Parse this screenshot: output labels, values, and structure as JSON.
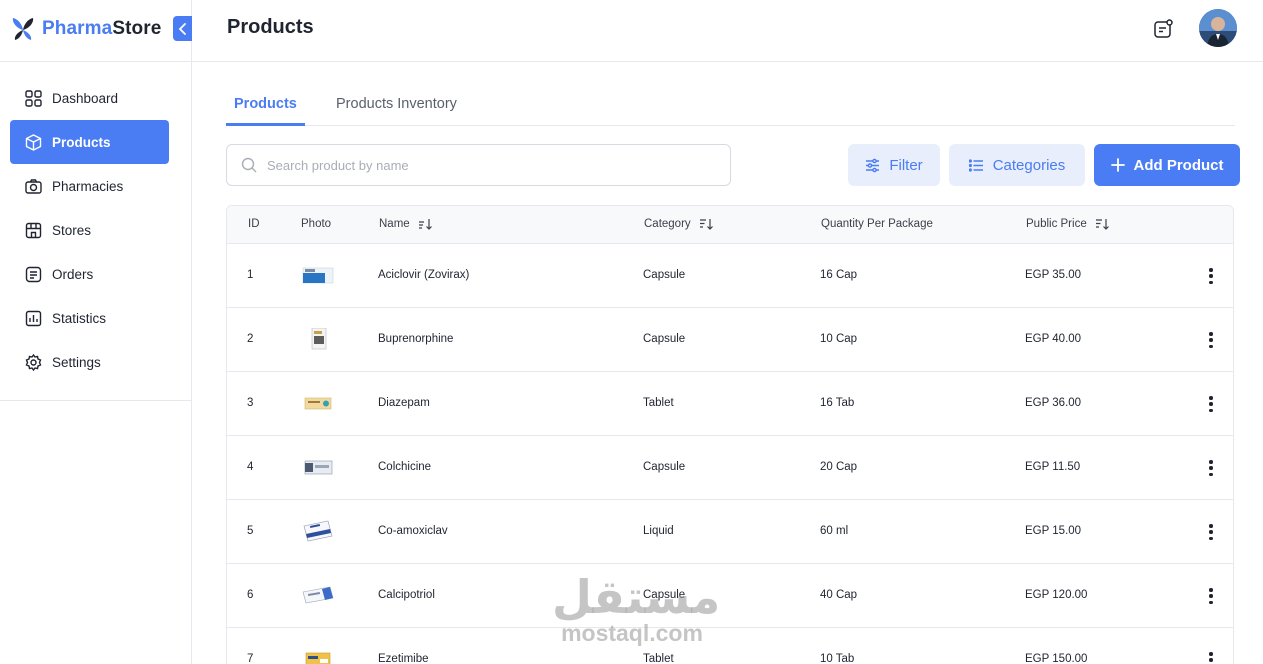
{
  "brand": {
    "name_part1": "Pharma",
    "name_part2": "Store"
  },
  "sidebar": {
    "items": [
      {
        "label": "Dashboard",
        "icon": "grid-icon"
      },
      {
        "label": "Products",
        "icon": "box-icon",
        "active": true
      },
      {
        "label": "Pharmacies",
        "icon": "camera-icon"
      },
      {
        "label": "Stores",
        "icon": "store-icon"
      },
      {
        "label": "Orders",
        "icon": "document-icon"
      },
      {
        "label": "Statistics",
        "icon": "bar-chart-icon"
      },
      {
        "label": "Settings",
        "icon": "gear-icon"
      }
    ]
  },
  "header": {
    "title": "Products"
  },
  "tabs": [
    {
      "label": "Products",
      "active": true
    },
    {
      "label": "Products Inventory",
      "active": false
    }
  ],
  "toolbar": {
    "search_placeholder": "Search product by name",
    "filter_label": "Filter",
    "categories_label": "Categories",
    "add_label": "Add Product"
  },
  "table": {
    "columns": [
      "ID",
      "Photo",
      "Name",
      "Category",
      "Quantity Per Package",
      "Public Price"
    ],
    "rows": [
      {
        "id": "1",
        "name": "Aciclovir (Zovirax)",
        "category": "Capsule",
        "quantity": "16 Cap",
        "price": "EGP 35.00"
      },
      {
        "id": "2",
        "name": "Buprenorphine",
        "category": "Capsule",
        "quantity": "10 Cap",
        "price": "EGP 40.00"
      },
      {
        "id": "3",
        "name": "Diazepam",
        "category": "Tablet",
        "quantity": "16 Tab",
        "price": "EGP 36.00"
      },
      {
        "id": "4",
        "name": "Colchicine",
        "category": "Capsule",
        "quantity": "20 Cap",
        "price": "EGP 11.50"
      },
      {
        "id": "5",
        "name": "Co-amoxiclav",
        "category": "Liquid",
        "quantity": "60 ml",
        "price": "EGP 15.00"
      },
      {
        "id": "6",
        "name": "Calcipotriol",
        "category": "Capsule",
        "quantity": "40 Cap",
        "price": "EGP 120.00"
      },
      {
        "id": "7",
        "name": "Ezetimibe",
        "category": "Tablet",
        "quantity": "10 Tab",
        "price": "EGP 150.00"
      }
    ]
  },
  "watermark": {
    "arabic": "مستقل",
    "latin": "mostaql.com"
  },
  "colors": {
    "accent": "#4a7cf3",
    "accent_light": "#e8eefc",
    "border": "#e6e8ee"
  }
}
